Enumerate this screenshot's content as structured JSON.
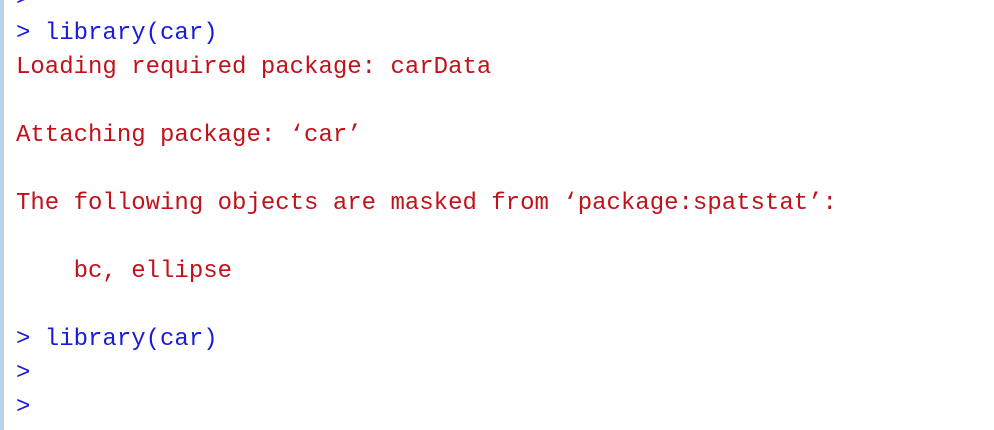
{
  "colors": {
    "input": "#1a1adb",
    "output": "#c1121b",
    "border": "#b9d3e8"
  },
  "console": {
    "lines": [
      {
        "type": "input",
        "text": ">"
      },
      {
        "type": "input",
        "text": "> library(car)"
      },
      {
        "type": "output",
        "text": "Loading required package: carData"
      },
      {
        "type": "output",
        "text": ""
      },
      {
        "type": "output",
        "text": "Attaching package: ‘car’"
      },
      {
        "type": "output",
        "text": ""
      },
      {
        "type": "output",
        "text": "The following objects are masked from ‘package:spatstat’:"
      },
      {
        "type": "output",
        "text": ""
      },
      {
        "type": "output",
        "text": "    bc, ellipse"
      },
      {
        "type": "output",
        "text": ""
      },
      {
        "type": "input",
        "text": "> library(car)"
      },
      {
        "type": "input",
        "text": ">"
      },
      {
        "type": "input",
        "text": ">"
      }
    ]
  }
}
